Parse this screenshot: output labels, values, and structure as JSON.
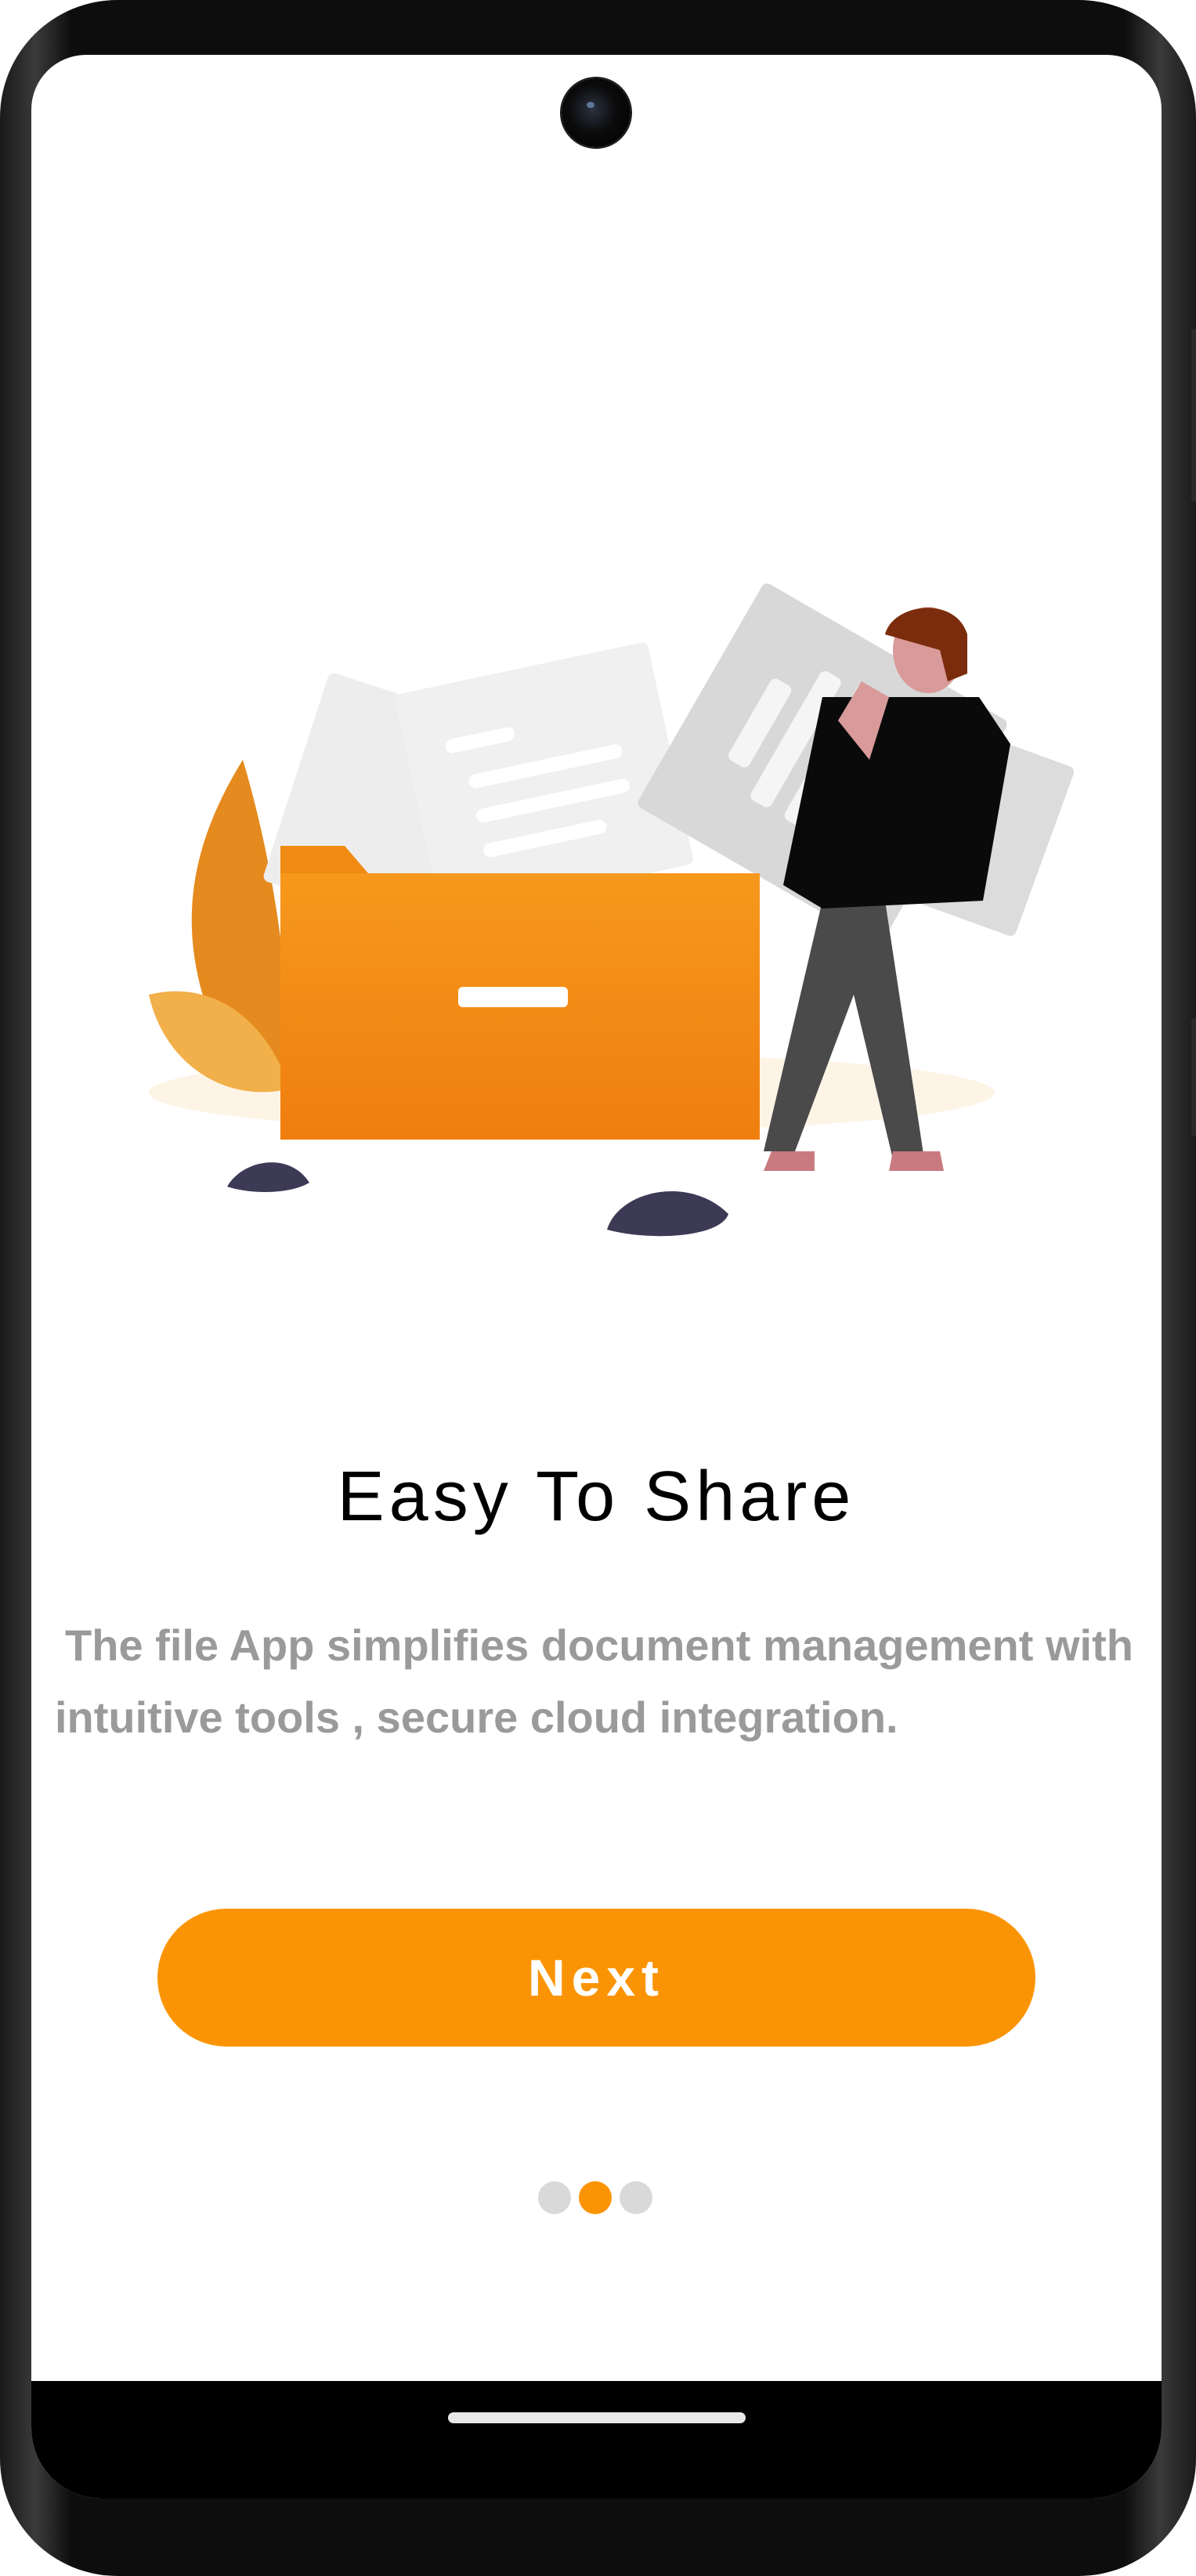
{
  "onboarding": {
    "title": "Easy To Share",
    "description": "The file App simplifies document management with intuitive tools , secure cloud integration.",
    "next_label": "Next",
    "page_indicator": {
      "total": 3,
      "active": 2
    }
  },
  "illustration": {
    "subject": "person-sorting-documents-into-folder"
  },
  "colors": {
    "accent": "#fb9404",
    "title_text": "#000000",
    "description_text": "#9a9a9a",
    "inactive_dot": "#d9d9d9"
  }
}
